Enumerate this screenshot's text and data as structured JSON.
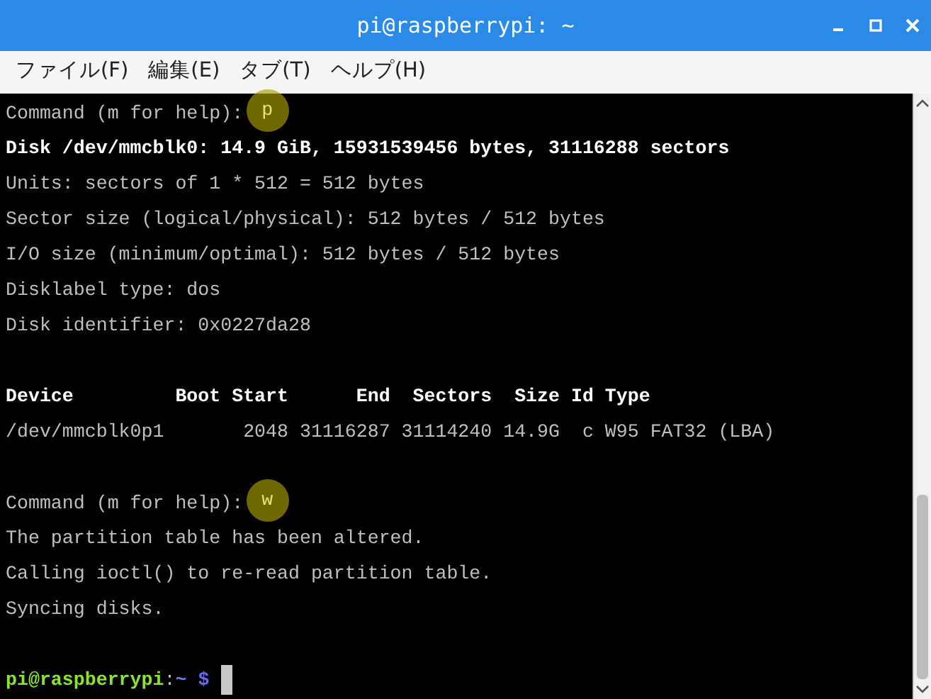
{
  "window": {
    "title": "pi@raspberrypi: ~"
  },
  "menu": [
    {
      "label": "ファイル(F)"
    },
    {
      "label": "編集(E)"
    },
    {
      "label": "タブ(T)"
    },
    {
      "label": "ヘルプ(H)"
    }
  ],
  "terminal": {
    "lines": [
      {
        "kind": "command",
        "text": "Command (m for help):",
        "input": "p"
      },
      {
        "kind": "bold",
        "text": "Disk /dev/mmcblk0: 14.9 GiB, 15931539456 bytes, 31116288 sectors"
      },
      {
        "kind": "normal",
        "text": "Units: sectors of 1 * 512 = 512 bytes"
      },
      {
        "kind": "normal",
        "text": "Sector size (logical/physical): 512 bytes / 512 bytes"
      },
      {
        "kind": "normal",
        "text": "I/O size (minimum/optimal): 512 bytes / 512 bytes"
      },
      {
        "kind": "normal",
        "text": "Disklabel type: dos"
      },
      {
        "kind": "normal",
        "text": "Disk identifier: 0x0227da28"
      },
      {
        "kind": "blank"
      },
      {
        "kind": "bold",
        "text": "Device         Boot Start      End  Sectors  Size Id Type"
      },
      {
        "kind": "normal",
        "text": "/dev/mmcblk0p1       2048 31116287 31114240 14.9G  c W95 FAT32 (LBA)"
      },
      {
        "kind": "blank"
      },
      {
        "kind": "command",
        "text": "Command (m for help):",
        "input": "w"
      },
      {
        "kind": "normal",
        "text": "The partition table has been altered."
      },
      {
        "kind": "normal",
        "text": "Calling ioctl() to re-read partition table."
      },
      {
        "kind": "normal",
        "text": "Syncing disks."
      },
      {
        "kind": "blank"
      },
      {
        "kind": "prompt",
        "user": "pi@raspberrypi",
        "separator": ":",
        "path": "~",
        "symbol": "$"
      }
    ]
  }
}
